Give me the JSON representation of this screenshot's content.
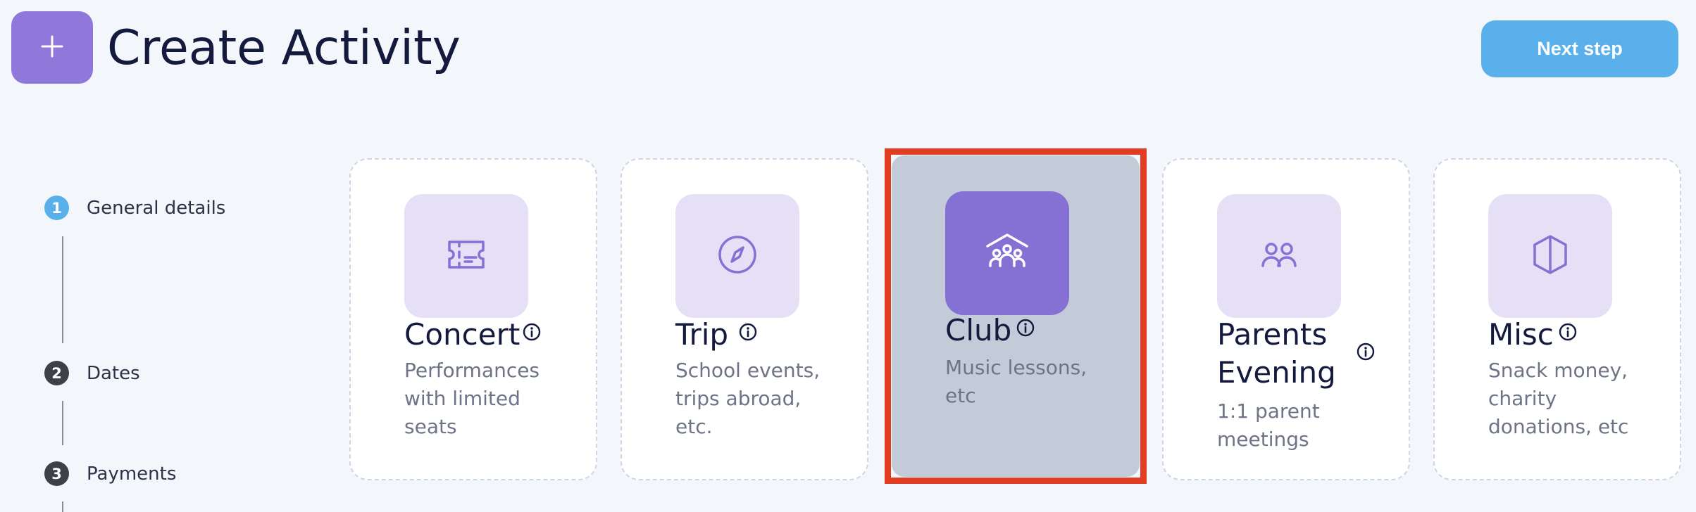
{
  "header": {
    "title": "Create Activity",
    "add_icon": "plus-icon",
    "next_label": "Next step"
  },
  "stepper": {
    "steps": [
      {
        "number": "1",
        "label": "General details",
        "color": "#59b0ea"
      },
      {
        "number": "2",
        "label": "Dates",
        "color": "#3d4046"
      },
      {
        "number": "3",
        "label": "Payments",
        "color": "#3d4046"
      }
    ]
  },
  "activity_types": [
    {
      "title": "Concert",
      "description": "Performances with limited seats",
      "icon": "ticket-icon",
      "selected": false
    },
    {
      "title": "Trip",
      "description": "School events, trips abroad, etc.",
      "icon": "compass-icon",
      "selected": false
    },
    {
      "title": "Club",
      "description": "Music lessons, etc",
      "icon": "group-house-icon",
      "selected": true
    },
    {
      "title": "Parents Evening",
      "description": "1:1 parent meetings",
      "icon": "two-people-icon",
      "selected": false
    },
    {
      "title": "Misc",
      "description": "Snack money, charity donations, etc",
      "icon": "cube-icon",
      "selected": false
    }
  ],
  "colors": {
    "accent_purple": "#8f78da",
    "next_button": "#59b0ea",
    "selection_outline": "#e23c23",
    "selected_card": "#c3cad8"
  }
}
